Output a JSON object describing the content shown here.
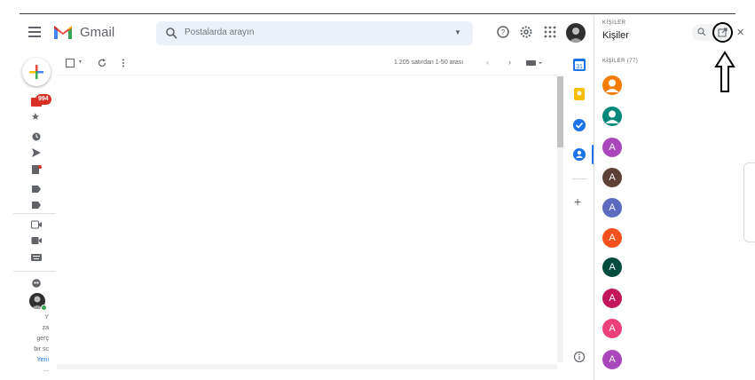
{
  "app": {
    "name": "Gmail",
    "search_placeholder": "Postalarda arayın"
  },
  "toolbar": {
    "pagination": "1.205 satırdan 1-50 arası"
  },
  "rail": {
    "inbox_badge": "994",
    "promo_lines": [
      "Y",
      "za",
      "gerç",
      "bir sc",
      "Yeni",
      "..."
    ]
  },
  "contacts_panel": {
    "label": "KİŞİLER",
    "title": "Kişiler",
    "section_label": "KİŞİLER (77)",
    "contacts": [
      {
        "initial": "",
        "color": "#f57c00"
      },
      {
        "initial": "",
        "color": "#00897b"
      },
      {
        "initial": "A",
        "color": "#ab47bc"
      },
      {
        "initial": "A",
        "color": "#5d4037"
      },
      {
        "initial": "A",
        "color": "#5c6bc0"
      },
      {
        "initial": "A",
        "color": "#f4511e"
      },
      {
        "initial": "A",
        "color": "#004d40"
      },
      {
        "initial": "A",
        "color": "#c2185b"
      },
      {
        "initial": "A",
        "color": "#ec407a"
      },
      {
        "initial": "A",
        "color": "#ab47bc"
      }
    ]
  },
  "colors": {
    "accent": "#1a73e8",
    "badge": "#d93025",
    "annotation": "#000000"
  }
}
